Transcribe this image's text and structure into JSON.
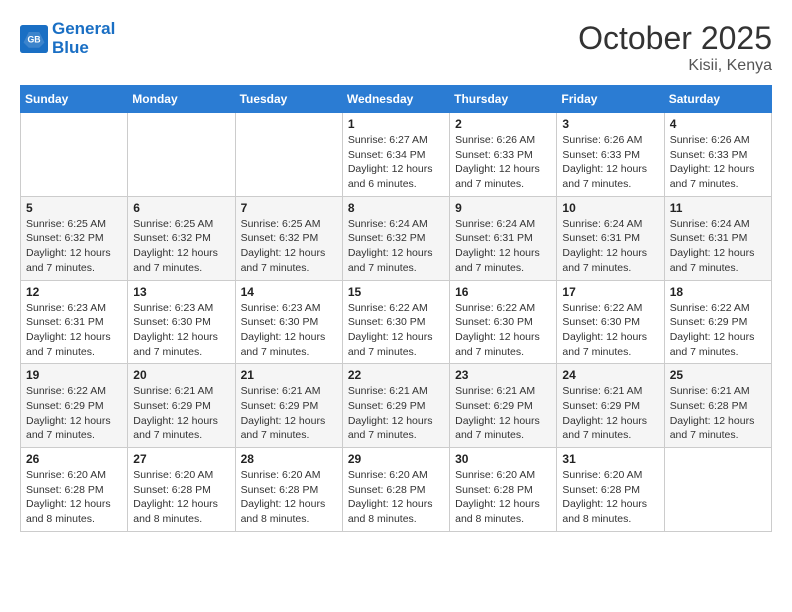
{
  "header": {
    "logo_line1": "General",
    "logo_line2": "Blue",
    "month": "October 2025",
    "location": "Kisii, Kenya"
  },
  "days_of_week": [
    "Sunday",
    "Monday",
    "Tuesday",
    "Wednesday",
    "Thursday",
    "Friday",
    "Saturday"
  ],
  "weeks": [
    [
      {
        "day": "",
        "sunrise": "",
        "sunset": "",
        "daylight": ""
      },
      {
        "day": "",
        "sunrise": "",
        "sunset": "",
        "daylight": ""
      },
      {
        "day": "",
        "sunrise": "",
        "sunset": "",
        "daylight": ""
      },
      {
        "day": "1",
        "sunrise": "Sunrise: 6:27 AM",
        "sunset": "Sunset: 6:34 PM",
        "daylight": "Daylight: 12 hours and 6 minutes."
      },
      {
        "day": "2",
        "sunrise": "Sunrise: 6:26 AM",
        "sunset": "Sunset: 6:33 PM",
        "daylight": "Daylight: 12 hours and 7 minutes."
      },
      {
        "day": "3",
        "sunrise": "Sunrise: 6:26 AM",
        "sunset": "Sunset: 6:33 PM",
        "daylight": "Daylight: 12 hours and 7 minutes."
      },
      {
        "day": "4",
        "sunrise": "Sunrise: 6:26 AM",
        "sunset": "Sunset: 6:33 PM",
        "daylight": "Daylight: 12 hours and 7 minutes."
      }
    ],
    [
      {
        "day": "5",
        "sunrise": "Sunrise: 6:25 AM",
        "sunset": "Sunset: 6:32 PM",
        "daylight": "Daylight: 12 hours and 7 minutes."
      },
      {
        "day": "6",
        "sunrise": "Sunrise: 6:25 AM",
        "sunset": "Sunset: 6:32 PM",
        "daylight": "Daylight: 12 hours and 7 minutes."
      },
      {
        "day": "7",
        "sunrise": "Sunrise: 6:25 AM",
        "sunset": "Sunset: 6:32 PM",
        "daylight": "Daylight: 12 hours and 7 minutes."
      },
      {
        "day": "8",
        "sunrise": "Sunrise: 6:24 AM",
        "sunset": "Sunset: 6:32 PM",
        "daylight": "Daylight: 12 hours and 7 minutes."
      },
      {
        "day": "9",
        "sunrise": "Sunrise: 6:24 AM",
        "sunset": "Sunset: 6:31 PM",
        "daylight": "Daylight: 12 hours and 7 minutes."
      },
      {
        "day": "10",
        "sunrise": "Sunrise: 6:24 AM",
        "sunset": "Sunset: 6:31 PM",
        "daylight": "Daylight: 12 hours and 7 minutes."
      },
      {
        "day": "11",
        "sunrise": "Sunrise: 6:24 AM",
        "sunset": "Sunset: 6:31 PM",
        "daylight": "Daylight: 12 hours and 7 minutes."
      }
    ],
    [
      {
        "day": "12",
        "sunrise": "Sunrise: 6:23 AM",
        "sunset": "Sunset: 6:31 PM",
        "daylight": "Daylight: 12 hours and 7 minutes."
      },
      {
        "day": "13",
        "sunrise": "Sunrise: 6:23 AM",
        "sunset": "Sunset: 6:30 PM",
        "daylight": "Daylight: 12 hours and 7 minutes."
      },
      {
        "day": "14",
        "sunrise": "Sunrise: 6:23 AM",
        "sunset": "Sunset: 6:30 PM",
        "daylight": "Daylight: 12 hours and 7 minutes."
      },
      {
        "day": "15",
        "sunrise": "Sunrise: 6:22 AM",
        "sunset": "Sunset: 6:30 PM",
        "daylight": "Daylight: 12 hours and 7 minutes."
      },
      {
        "day": "16",
        "sunrise": "Sunrise: 6:22 AM",
        "sunset": "Sunset: 6:30 PM",
        "daylight": "Daylight: 12 hours and 7 minutes."
      },
      {
        "day": "17",
        "sunrise": "Sunrise: 6:22 AM",
        "sunset": "Sunset: 6:30 PM",
        "daylight": "Daylight: 12 hours and 7 minutes."
      },
      {
        "day": "18",
        "sunrise": "Sunrise: 6:22 AM",
        "sunset": "Sunset: 6:29 PM",
        "daylight": "Daylight: 12 hours and 7 minutes."
      }
    ],
    [
      {
        "day": "19",
        "sunrise": "Sunrise: 6:22 AM",
        "sunset": "Sunset: 6:29 PM",
        "daylight": "Daylight: 12 hours and 7 minutes."
      },
      {
        "day": "20",
        "sunrise": "Sunrise: 6:21 AM",
        "sunset": "Sunset: 6:29 PM",
        "daylight": "Daylight: 12 hours and 7 minutes."
      },
      {
        "day": "21",
        "sunrise": "Sunrise: 6:21 AM",
        "sunset": "Sunset: 6:29 PM",
        "daylight": "Daylight: 12 hours and 7 minutes."
      },
      {
        "day": "22",
        "sunrise": "Sunrise: 6:21 AM",
        "sunset": "Sunset: 6:29 PM",
        "daylight": "Daylight: 12 hours and 7 minutes."
      },
      {
        "day": "23",
        "sunrise": "Sunrise: 6:21 AM",
        "sunset": "Sunset: 6:29 PM",
        "daylight": "Daylight: 12 hours and 7 minutes."
      },
      {
        "day": "24",
        "sunrise": "Sunrise: 6:21 AM",
        "sunset": "Sunset: 6:29 PM",
        "daylight": "Daylight: 12 hours and 7 minutes."
      },
      {
        "day": "25",
        "sunrise": "Sunrise: 6:21 AM",
        "sunset": "Sunset: 6:28 PM",
        "daylight": "Daylight: 12 hours and 7 minutes."
      }
    ],
    [
      {
        "day": "26",
        "sunrise": "Sunrise: 6:20 AM",
        "sunset": "Sunset: 6:28 PM",
        "daylight": "Daylight: 12 hours and 8 minutes."
      },
      {
        "day": "27",
        "sunrise": "Sunrise: 6:20 AM",
        "sunset": "Sunset: 6:28 PM",
        "daylight": "Daylight: 12 hours and 8 minutes."
      },
      {
        "day": "28",
        "sunrise": "Sunrise: 6:20 AM",
        "sunset": "Sunset: 6:28 PM",
        "daylight": "Daylight: 12 hours and 8 minutes."
      },
      {
        "day": "29",
        "sunrise": "Sunrise: 6:20 AM",
        "sunset": "Sunset: 6:28 PM",
        "daylight": "Daylight: 12 hours and 8 minutes."
      },
      {
        "day": "30",
        "sunrise": "Sunrise: 6:20 AM",
        "sunset": "Sunset: 6:28 PM",
        "daylight": "Daylight: 12 hours and 8 minutes."
      },
      {
        "day": "31",
        "sunrise": "Sunrise: 6:20 AM",
        "sunset": "Sunset: 6:28 PM",
        "daylight": "Daylight: 12 hours and 8 minutes."
      },
      {
        "day": "",
        "sunrise": "",
        "sunset": "",
        "daylight": ""
      }
    ]
  ]
}
